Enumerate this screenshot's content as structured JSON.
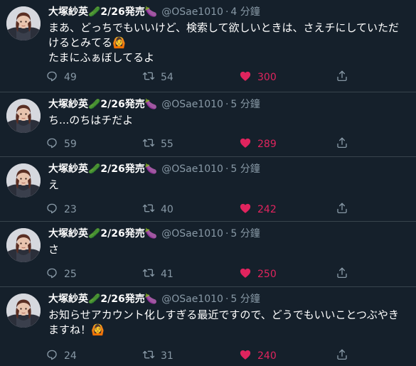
{
  "tweets": [
    {
      "name": "大塚紗英🥒2/26発売🍆",
      "handle": "@OSae1010",
      "separator": "·",
      "time": "4 分鐘",
      "text_lines": [
        "まあ、どっちでもいいけど、検索して欲しいときは、さえチにしていただ",
        "けるとみてる🙆",
        "たまにふぁぼしてるよ"
      ],
      "reply_count": "49",
      "retweet_count": "54",
      "like_count": "300"
    },
    {
      "name": "大塚紗英🥒2/26発売🍆",
      "handle": "@OSae1010",
      "separator": "·",
      "time": "5 分鐘",
      "text_lines": [
        "ち...のちはチだよ"
      ],
      "reply_count": "59",
      "retweet_count": "55",
      "like_count": "289"
    },
    {
      "name": "大塚紗英🥒2/26発売🍆",
      "handle": "@OSae1010",
      "separator": "·",
      "time": "5 分鐘",
      "text_lines": [
        "え"
      ],
      "reply_count": "23",
      "retweet_count": "40",
      "like_count": "242"
    },
    {
      "name": "大塚紗英🥒2/26発売🍆",
      "handle": "@OSae1010",
      "separator": "·",
      "time": "5 分鐘",
      "text_lines": [
        "さ"
      ],
      "reply_count": "25",
      "retweet_count": "41",
      "like_count": "250"
    },
    {
      "name": "大塚紗英🥒2/26発売🍆",
      "handle": "@OSae1010",
      "separator": "·",
      "time": "5 分鐘",
      "text_lines": [
        "お知らせアカウント化しすぎる最近ですので、どうでもいいことつぶやき",
        "ますね！🙆"
      ],
      "reply_count": "24",
      "retweet_count": "31",
      "like_count": "240"
    }
  ],
  "colors": {
    "background": "#15202b",
    "secondary_text": "#8899a6",
    "like": "#e0245e",
    "divider": "#38444d"
  },
  "icons": [
    "avatar",
    "reply-icon",
    "retweet-icon",
    "heart-icon",
    "share-icon"
  ]
}
